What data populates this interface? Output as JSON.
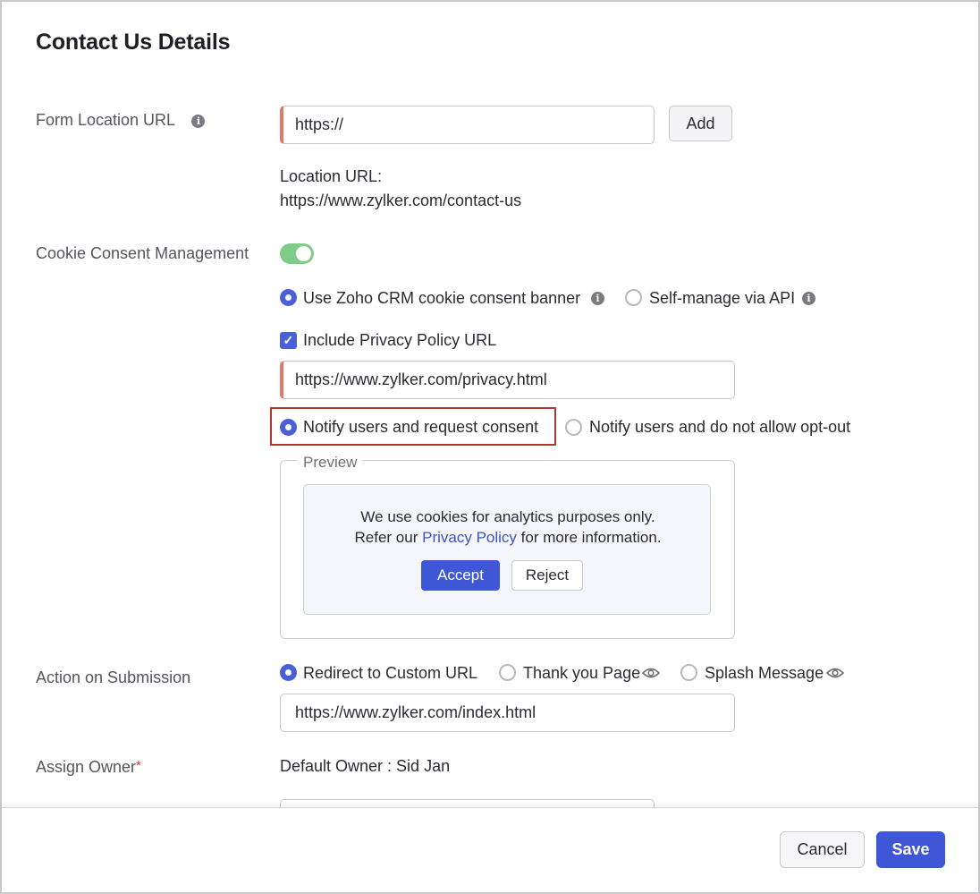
{
  "header": {
    "title": "Contact Us Details"
  },
  "form_location": {
    "label": "Form Location URL",
    "input_value": "https://",
    "add_label": "Add",
    "location_caption": "Location URL:",
    "location_value": "https://www.zylker.com/contact-us"
  },
  "cookie": {
    "label": "Cookie Consent Management",
    "enabled": true,
    "options": [
      {
        "label": "Use Zoho CRM cookie consent banner",
        "selected": true
      },
      {
        "label": "Self-manage via API",
        "selected": false
      }
    ],
    "privacy_checkbox_label": "Include Privacy Policy URL",
    "privacy_checked": true,
    "privacy_url": "https://www.zylker.com/privacy.html",
    "consent_options": [
      {
        "label": "Notify users and request consent",
        "selected": true
      },
      {
        "label": "Notify users and do not allow opt-out",
        "selected": false
      }
    ],
    "preview": {
      "legend": "Preview",
      "line1": "We use cookies for analytics purposes only.",
      "line2_prefix": "Refer our",
      "line2_link": "Privacy Policy",
      "line2_suffix": "for more information.",
      "accept_label": "Accept",
      "reject_label": "Reject"
    }
  },
  "submission": {
    "label": "Action on Submission",
    "options": [
      {
        "label": "Redirect to Custom URL",
        "selected": true
      },
      {
        "label": "Thank you Page",
        "selected": false
      },
      {
        "label": "Splash Message",
        "selected": false
      }
    ],
    "url": "https://www.zylker.com/index.html"
  },
  "owner": {
    "label": "Assign Owner",
    "required_mark": "*",
    "default_text": "Default Owner : Sid Jan"
  },
  "footer": {
    "cancel_label": "Cancel",
    "save_label": "Save"
  },
  "colors": {
    "accent": "#3f56d6",
    "toggle_on": "#7fcb8a",
    "required": "#d33b2e",
    "highlight": "#b0392f"
  }
}
